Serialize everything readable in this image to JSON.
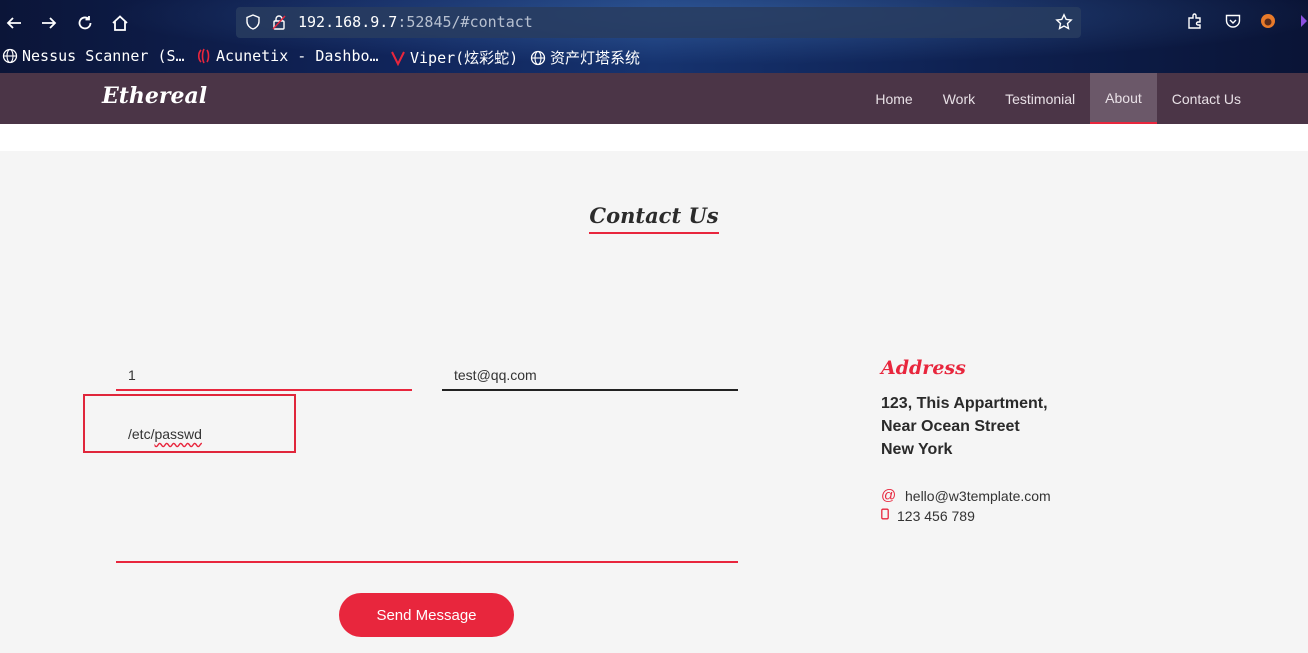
{
  "browser": {
    "url_host": "192.168.9.7",
    "url_rest": ":52845/#contact",
    "bookmarks": [
      "Nessus Scanner (S…",
      "Acunetix - Dashbo…",
      "Viper(炫彩蛇)",
      "资产灯塔系统"
    ]
  },
  "site": {
    "brand": "Ethereal",
    "nav": [
      "Home",
      "Work",
      "Testimonial",
      "About",
      "Contact Us"
    ],
    "active_nav": "About"
  },
  "contact": {
    "title": "Contact Us",
    "name_value": "1",
    "email_value": "test@qq.com",
    "message_prefix": "/etc/",
    "message_word": "passwd",
    "send_label": "Send Message",
    "address_title": "Address",
    "address_lines": [
      "123, This Appartment,",
      "Near Ocean Street",
      "New York"
    ],
    "email": "hello@w3template.com",
    "phone": "123 456 789"
  },
  "colors": {
    "accent": "#e8263d",
    "nav_bg": "#4b3547"
  }
}
